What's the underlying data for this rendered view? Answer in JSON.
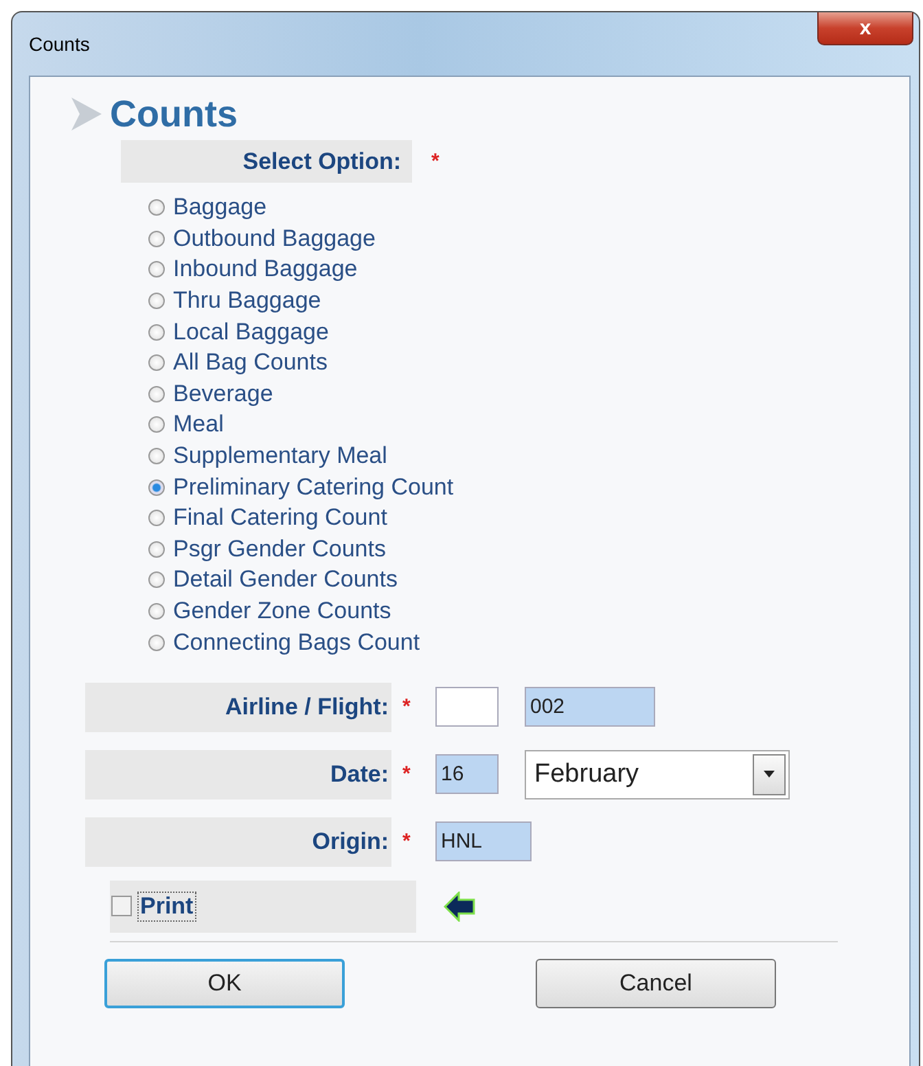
{
  "window": {
    "title": "Counts",
    "close": "x"
  },
  "heading": "Counts",
  "select_option": {
    "label": "Select Option:",
    "required": "*"
  },
  "options": [
    {
      "label": "Baggage",
      "selected": false
    },
    {
      "label": "Outbound Baggage",
      "selected": false
    },
    {
      "label": "Inbound Baggage",
      "selected": false
    },
    {
      "label": "Thru Baggage",
      "selected": false
    },
    {
      "label": "Local Baggage",
      "selected": false
    },
    {
      "label": "All Bag Counts",
      "selected": false
    },
    {
      "label": "Beverage",
      "selected": false
    },
    {
      "label": "Meal",
      "selected": false
    },
    {
      "label": "Supplementary Meal",
      "selected": false
    },
    {
      "label": "Preliminary Catering Count",
      "selected": true
    },
    {
      "label": "Final Catering Count",
      "selected": false
    },
    {
      "label": "Psgr Gender Counts",
      "selected": false
    },
    {
      "label": "Detail Gender Counts",
      "selected": false
    },
    {
      "label": "Gender Zone Counts",
      "selected": false
    },
    {
      "label": "Connecting Bags Count",
      "selected": false
    }
  ],
  "fields": [
    {
      "label": "Airline / Flight:",
      "required": "*",
      "inputs": [
        {
          "kind": "text",
          "filled": false
        },
        {
          "kind": "text",
          "value": "002",
          "filled": true
        }
      ]
    },
    {
      "label": "Date:",
      "required": "*",
      "inputs": [
        {
          "kind": "text",
          "value": "16",
          "filled": true
        },
        {
          "kind": "select",
          "value": "February",
          "filled": false
        }
      ]
    },
    {
      "label": "Origin:",
      "required": "*",
      "inputs": [
        {
          "kind": "text",
          "value": "HNL",
          "filled": true
        }
      ]
    }
  ],
  "print": {
    "label": "Print",
    "checked": false
  },
  "buttons": [
    {
      "label": "OK",
      "default": true
    },
    {
      "label": "Cancel",
      "default": false
    }
  ]
}
